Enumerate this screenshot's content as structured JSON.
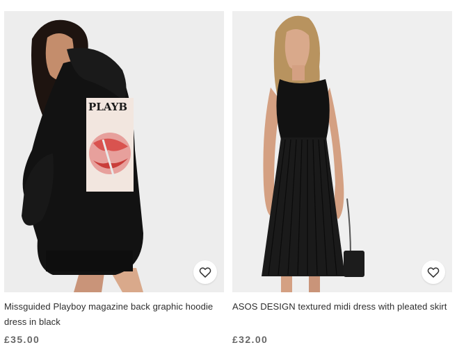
{
  "products": [
    {
      "title": "Missguided Playboy magazine back graphic hoodie dress in black",
      "price": "£35.00",
      "save_icon": "heart-outline-icon",
      "print_text": "PLAYB"
    },
    {
      "title": "ASOS DESIGN textured midi dress with pleated skirt",
      "price": "£32.00",
      "save_icon": "heart-outline-icon"
    }
  ],
  "colors": {
    "image_background": "#eeeeee",
    "text": "#2d2d2d",
    "price": "#666666"
  }
}
